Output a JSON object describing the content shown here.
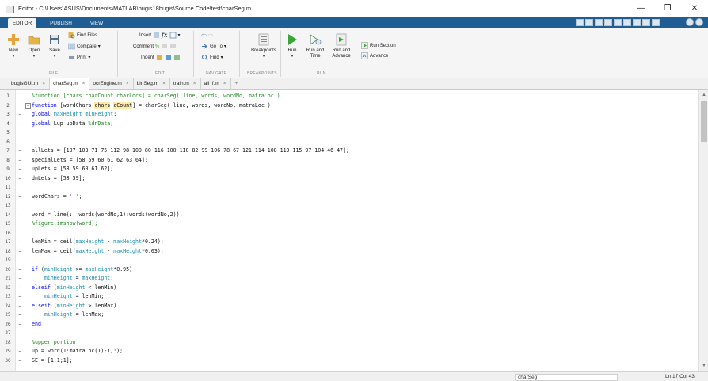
{
  "window": {
    "title": "Editor - C:\\Users\\ASUS\\Documents\\MATLAB\\bugis18bugis\\Source Code\\test\\charSeg.m",
    "controls": [
      "—",
      "❐",
      "✕"
    ]
  },
  "tabs": [
    {
      "label": "EDITOR",
      "active": true
    },
    {
      "label": "PUBLISH",
      "active": false
    },
    {
      "label": "VIEW",
      "active": false
    }
  ],
  "toolstrip": {
    "file": {
      "new": "New",
      "open": "Open",
      "save": "Save",
      "find_files": "Find Files",
      "compare": "Compare",
      "print": "Print",
      "section": "FILE"
    },
    "edit": {
      "insert": "Insert",
      "comment": "Comment",
      "indent": "Indent",
      "fx": "fx",
      "section": "EDIT"
    },
    "navigate": {
      "go_to": "Go To",
      "find": "Find",
      "section": "NAVIGATE"
    },
    "breakpoints": {
      "label": "Breakpoints",
      "section": "BREAKPOINTS"
    },
    "run": {
      "run": "Run",
      "run_and_time_1": "Run and",
      "run_and_time_2": "Time",
      "run_and_advance_1": "Run and",
      "run_and_advance_2": "Advance",
      "run_section": "Run Section",
      "advance": "Advance",
      "section": "RUN"
    },
    "colors": {
      "tab_bar": "#1f5d93",
      "run_green": "#3aa63a"
    }
  },
  "file_tabs": [
    {
      "name": "bugisGUI.m",
      "active": false
    },
    {
      "name": "charSeg.m",
      "active": true
    },
    {
      "name": "ocrEngine.m",
      "active": false
    },
    {
      "name": "binSeg.m",
      "active": false
    },
    {
      "name": "train.m",
      "active": false
    },
    {
      "name": "all_f.m",
      "active": false
    }
  ],
  "file_tab_close": "×",
  "file_tab_add": "+",
  "code_lines": [
    {
      "n": "1",
      "dash": "",
      "html": "<span class=\"cmt\">%function [chars charCount charLocs] = charSeg( line, words, wordNo, matraLoc )</span>"
    },
    {
      "n": "2",
      "dash": "",
      "fold": "−",
      "html": "<span class=\"kw\">function</span> [wordChars <span class=\"hl\">chars</span> <span class=\"hl\">cCount</span>] = charSeg( line, words, wordNo, matraLoc )"
    },
    {
      "n": "3",
      "dash": "−",
      "html": "<span class=\"kw\">global</span> <span class=\"var\">maxHeight minHeight</span>;"
    },
    {
      "n": "4",
      "dash": "−",
      "html": "<span class=\"kw\">global</span> Lup upData <span class=\"cmt\">%dnData;</span>"
    },
    {
      "n": "5",
      "dash": "",
      "html": ""
    },
    {
      "n": "6",
      "dash": "",
      "html": ""
    },
    {
      "n": "7",
      "dash": "−",
      "html": "allLets = [107 103 71 75 112 98 109 80 116 100 110 82 99 106 78 67 121 114 108 119 115 97 104 46 47];"
    },
    {
      "n": "8",
      "dash": "−",
      "html": "specialLets = [58 59 60 61 62 63 64];"
    },
    {
      "n": "9",
      "dash": "−",
      "html": "upLets = [58 59 60 61 62];"
    },
    {
      "n": "10",
      "dash": "−",
      "html": "dnLets = [58 59];"
    },
    {
      "n": "11",
      "dash": "",
      "html": ""
    },
    {
      "n": "12",
      "dash": "−",
      "html": "wordChars = <span class=\"str\">' '</span>;"
    },
    {
      "n": "13",
      "dash": "",
      "html": ""
    },
    {
      "n": "14",
      "dash": "−",
      "html": "word = line(:, words(wordNo,1):words(wordNo,2));"
    },
    {
      "n": "15",
      "dash": "",
      "html": "<span class=\"cmt\">%figure,imshow(word);</span>"
    },
    {
      "n": "16",
      "dash": "",
      "html": ""
    },
    {
      "n": "17",
      "dash": "−",
      "html": "lenMin = ceil(<span class=\"var\">maxHeight</span> - <span class=\"var\">maxHeight</span>*0.24);"
    },
    {
      "n": "18",
      "dash": "−",
      "html": "lenMax = ceil(<span class=\"var\">maxHeight</span> - <span class=\"var\">maxHeight</span>*0.03);"
    },
    {
      "n": "19",
      "dash": "",
      "html": ""
    },
    {
      "n": "20",
      "dash": "−",
      "html": "<span class=\"kw\">if</span> (<span class=\"var\">minHeight</span> &gt;= <span class=\"var\">maxHeight</span>*0.95)"
    },
    {
      "n": "21",
      "dash": "−",
      "html": "    <span class=\"var\">minHeight</span> = <span class=\"var\">maxHeight</span>;"
    },
    {
      "n": "22",
      "dash": "−",
      "html": "<span class=\"kw\">elseif</span> (<span class=\"var\">minHeight</span> &lt; lenMin)"
    },
    {
      "n": "23",
      "dash": "−",
      "html": "    <span class=\"var\">minHeight</span> = lenMin;"
    },
    {
      "n": "24",
      "dash": "−",
      "html": "<span class=\"kw\">elseif</span> (<span class=\"var\">minHeight</span> &gt; lenMax)"
    },
    {
      "n": "25",
      "dash": "−",
      "html": "    <span class=\"var\">minHeight</span> = lenMax;"
    },
    {
      "n": "26",
      "dash": "−",
      "html": "<span class=\"kw\">end</span>"
    },
    {
      "n": "27",
      "dash": "",
      "html": ""
    },
    {
      "n": "28",
      "dash": "",
      "html": "<span class=\"cmt\">%upper portion</span>"
    },
    {
      "n": "29",
      "dash": "−",
      "html": "up = word(1:matraLoc(1)-1,:);"
    },
    {
      "n": "30",
      "dash": "−",
      "html": "SE = [1;1;1];"
    }
  ],
  "status": {
    "function_name": "charSeg",
    "position": "Ln  17    Col  43"
  }
}
